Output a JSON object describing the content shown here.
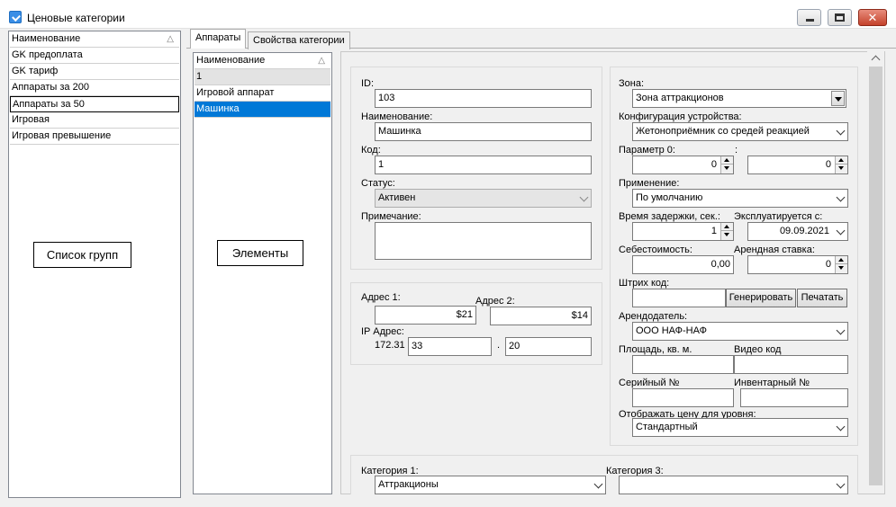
{
  "window": {
    "title": "Ценовые категории"
  },
  "groups_list": {
    "header": "Наименование",
    "items": [
      "GK  предоплата",
      "GK тариф",
      "Аппараты за 200",
      "Аппараты за 50",
      "Игровая",
      "Игровая превышение"
    ],
    "callout": "Список групп"
  },
  "tabs": [
    "Аппараты",
    "Свойства категории"
  ],
  "elements_list": {
    "header": "Наименование",
    "items": [
      "1",
      "Игровой аппарат",
      "Машинка"
    ],
    "callout": "Элементы"
  },
  "colors": {
    "selection": "#0078d7",
    "row_gray": "#e3e3e3",
    "close_button": "#c4422b"
  },
  "form": {
    "id_label": "ID:",
    "id_value": "103",
    "name_label": "Наименование:",
    "name_value": "Машинка",
    "code_label": "Код:",
    "code_value": "1",
    "status_label": "Статус:",
    "status_value": "Активен",
    "note_label": "Примечание:",
    "note_value": "",
    "addr1_label": "Адрес 1:",
    "addr1_value": "$21",
    "addr2_label": "Адрес 2:",
    "addr2_value": "$14",
    "ip_label": "IP Адрес:",
    "ip_prefix": "172.31",
    "ip_part3": "33",
    "ip_dot": ".",
    "ip_part4": "20",
    "zone_label": "Зона:",
    "zone_value": "Зона аттракционов",
    "config_label": "Конфигурация устройства:",
    "config_value": "Жетоноприёмник со средей реакцией",
    "param0_label": "Параметр 0:",
    "param_colon": ":",
    "param0_value": "0",
    "param0b_value": "0",
    "apply_label": "Применение:",
    "apply_value": "По умолчанию",
    "delay_label": "Время задержки, сек.:",
    "delay_value": "1",
    "operated_label": "Эксплуатируется с:",
    "operated_value": "09.09.2021",
    "cost_label": "Себестоимость:",
    "cost_value": "0,00",
    "rent_label": "Арендная ставка:",
    "rent_value": "0",
    "barcode_label": "Штрих код:",
    "barcode_value": "",
    "generate_btn": "Генерировать",
    "print_btn": "Печатать",
    "landlord_label": "Арендодатель:",
    "landlord_value": "ООО НАФ-НАФ",
    "area_label": "Площадь, кв. м.",
    "area_value": "",
    "videocode_label": "Видео код",
    "videocode_value": "",
    "serial_label": "Серийный №",
    "serial_value": "",
    "inventory_label": "Инвентарный №",
    "inventory_value": "",
    "price_level_label": "Отображать цену для уровня:",
    "price_level_value": "Стандартный",
    "cat1_label": "Категория 1:",
    "cat1_value": "Аттракционы",
    "cat3_label": "Категория 3:",
    "cat3_value": ""
  }
}
